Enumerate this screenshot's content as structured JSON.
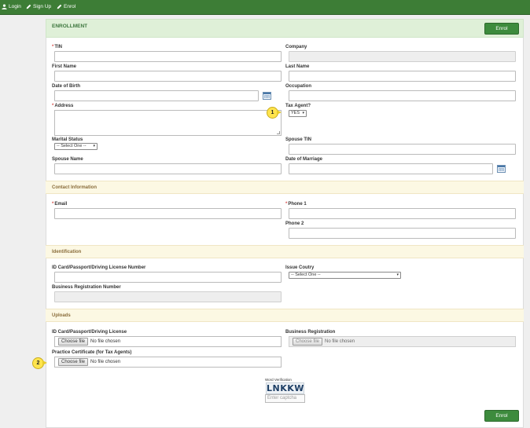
{
  "nav": {
    "login": "Login",
    "signup": "Sign Up",
    "enrol": "Enrol"
  },
  "header": {
    "title": "ENROLLMENT",
    "enrol_button": "Enrol"
  },
  "fields": {
    "tin": "TIN",
    "company": "Company",
    "first_name": "First Name",
    "last_name": "Last Name",
    "dob": "Date of Birth",
    "occupation": "Occupation",
    "address": "Address",
    "tax_agent": "Tax Agent?",
    "tax_agent_value": "YES",
    "marital_status": "Marital Status",
    "marital_status_value": "-- Select One --",
    "spouse_tin": "Spouse TIN",
    "spouse_name": "Spouse Name",
    "date_of_marriage": "Date of Marriage"
  },
  "required_marker": "*",
  "contact": {
    "title": "Contact Information",
    "email": "Email",
    "phone1": "Phone 1",
    "phone2": "Phone 2"
  },
  "identification": {
    "title": "Identification",
    "id_card": "ID Card/Passport/Driving License Number",
    "issue_country": "Issue Coutry",
    "issue_country_value": "-- Select One --",
    "business_reg_number": "Business Registration Number"
  },
  "uploads": {
    "title": "Uploads",
    "id_card": "ID Card/Passport/Driving License",
    "business_registration": "Business Registration",
    "practice_certificate": "Practice Certificate (for Tax Agents)",
    "choose_file": "Choose file",
    "no_file": "No file chosen"
  },
  "captcha": {
    "caption": "Word Verification",
    "image_text": "LNKKW",
    "placeholder": "Enter captcha"
  },
  "footer": {
    "enrol_button": "Enrol"
  },
  "callouts": {
    "one": "1",
    "two": "2"
  },
  "colors": {
    "nav": "#3d7d36",
    "button": "#3d8b3d",
    "header_bg": "#dff0d8",
    "section_bg": "#fcf8e3",
    "callout": "#ffe44d"
  },
  "icons": [
    "user-icon",
    "pencil-icon",
    "calendar-icon"
  ]
}
